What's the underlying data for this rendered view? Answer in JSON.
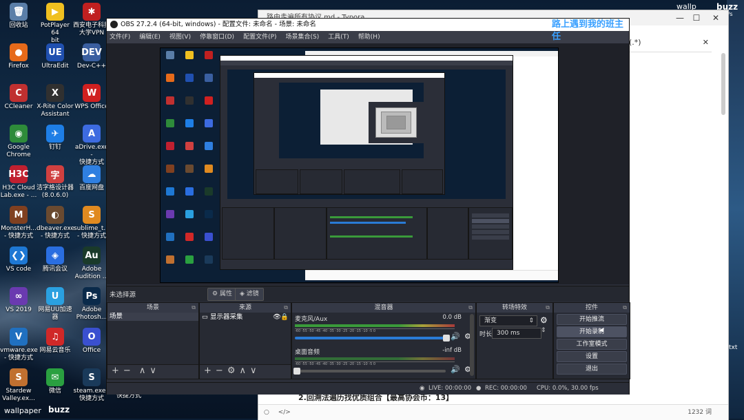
{
  "desktop": {
    "icons": [
      {
        "label": "回收站",
        "glyph": "🗑",
        "color": "#5a7ea8"
      },
      {
        "label": "PotPlayer 64\nbit",
        "glyph": "▶",
        "color": "#f0c020"
      },
      {
        "label": "西安电子科技\n大学VPN",
        "glyph": "✱",
        "color": "#c02020"
      },
      {
        "label": "Firefox",
        "glyph": "●",
        "color": "#e66a1a"
      },
      {
        "label": "UltraEdit",
        "glyph": "UE",
        "color": "#2050b0"
      },
      {
        "label": "Dev-C++",
        "glyph": "DEV",
        "color": "#3a5fa0"
      },
      {
        "label": "CCleaner",
        "glyph": "C",
        "color": "#c03030"
      },
      {
        "label": "X-Rite Color\nAssistant",
        "glyph": "X",
        "color": "#303030"
      },
      {
        "label": "WPS Office",
        "glyph": "W",
        "color": "#d02020"
      },
      {
        "label": "Google\nChrome",
        "glyph": "◉",
        "color": "#2e8b3a"
      },
      {
        "label": "钉钉",
        "glyph": "✈",
        "color": "#1e7ee6"
      },
      {
        "label": "aDrive.exe -\n快捷方式",
        "glyph": "A",
        "color": "#3d6be0"
      },
      {
        "label": "H3C Cloud\nLab.exe - ...",
        "glyph": "H3C",
        "color": "#c02030"
      },
      {
        "label": "洁字格设计器\n(8.0.6.0)",
        "glyph": "字",
        "color": "#d04040"
      },
      {
        "label": "百度网盘",
        "glyph": "☁",
        "color": "#2f7fe0"
      },
      {
        "label": "MonsterH...\n- 快捷方式",
        "glyph": "M",
        "color": "#804020"
      },
      {
        "label": "dbeaver.exe\n- 快捷方式",
        "glyph": "◐",
        "color": "#6a4a30"
      },
      {
        "label": "sublime_t...\n- 快捷方式",
        "glyph": "S",
        "color": "#e08a20"
      },
      {
        "label": "VS code",
        "glyph": "❮❯",
        "color": "#1e78d4"
      },
      {
        "label": "腾讯会议",
        "glyph": "◈",
        "color": "#2a6ee0"
      },
      {
        "label": "Adobe\nAudition ...",
        "glyph": "Au",
        "color": "#1a3a2a"
      },
      {
        "label": "VS 2019",
        "glyph": "∞",
        "color": "#6a3ab0"
      },
      {
        "label": "网易UU加速\n器",
        "glyph": "U",
        "color": "#2aa0e0"
      },
      {
        "label": "Adobe\nPhotosh...",
        "glyph": "Ps",
        "color": "#0a2a4a"
      },
      {
        "label": "vmware.exe\n- 快捷方式",
        "glyph": "V",
        "color": "#2070c0"
      },
      {
        "label": "网易云音乐",
        "glyph": "♫",
        "color": "#d02828"
      },
      {
        "label": "Office",
        "glyph": "O",
        "color": "#3a50d0"
      },
      {
        "label": "Stardew\nValley.ex...",
        "glyph": "S",
        "color": "#c07030"
      },
      {
        "label": "微信",
        "glyph": "✉",
        "color": "#2aa040"
      },
      {
        "label": "steam.exe -\n快捷方式",
        "glyph": "S",
        "color": "#1a3a5a"
      }
    ],
    "extra_label": "快捷方式",
    "bottom_left": "wallpaper",
    "bottom_buzz": "buzz",
    "top_right_text": "buzz",
    "top_right_speed": "KB/s",
    "top_right_wallp": "wallp",
    "right_edge_text": "txt"
  },
  "typora": {
    "title": "路由走遍所有协议.md - Typora",
    "search_text": "(.*)",
    "headline": "2.回溯法遍历找优质组合【最高协会币：13】",
    "word_count": "1232 词",
    "close": "✕"
  },
  "obs": {
    "title": "OBS 27.2.4 (64-bit, windows) - 配置文件: 未命名 - 场景: 未命名",
    "watermark": "路上遇到我的班主任",
    "menu": [
      "文件(F)",
      "编辑(E)",
      "视图(V)",
      "停靠窗口(D)",
      "配置文件(P)",
      "场景集合(S)",
      "工具(T)",
      "帮助(H)"
    ],
    "no_source": "未选择源",
    "properties_btn": "属性",
    "filters_btn": "滤镜",
    "scenes": {
      "title": "场景",
      "items": [
        "场景"
      ]
    },
    "sources": {
      "title": "来源",
      "items": [
        "显示器采集"
      ]
    },
    "mixer": {
      "title": "混音器",
      "tracks": [
        {
          "name": "麦克风/Aux",
          "db": "0.0 dB",
          "scale": "-60  -55  -50  -45  -40  -35  -30  -25  -20  -15  -10  -5  0"
        },
        {
          "name": "桌面音频",
          "db": "-inf dB",
          "scale": "-60  -55  -50  -45  -40  -35  -30  -25  -20  -15  -10  -5  0"
        }
      ]
    },
    "transitions": {
      "title": "转场特效",
      "type": "渐变",
      "duration_label": "时长",
      "duration_value": "300 ms"
    },
    "controls": {
      "title": "控件",
      "buttons": [
        "开始推流",
        "开始录制",
        "工作室模式",
        "设置",
        "退出"
      ]
    },
    "status": {
      "live": "LIVE: 00:00:00",
      "rec": "REC: 00:00:00",
      "cpu": "CPU: 0.0%, 30.00 fps"
    }
  }
}
